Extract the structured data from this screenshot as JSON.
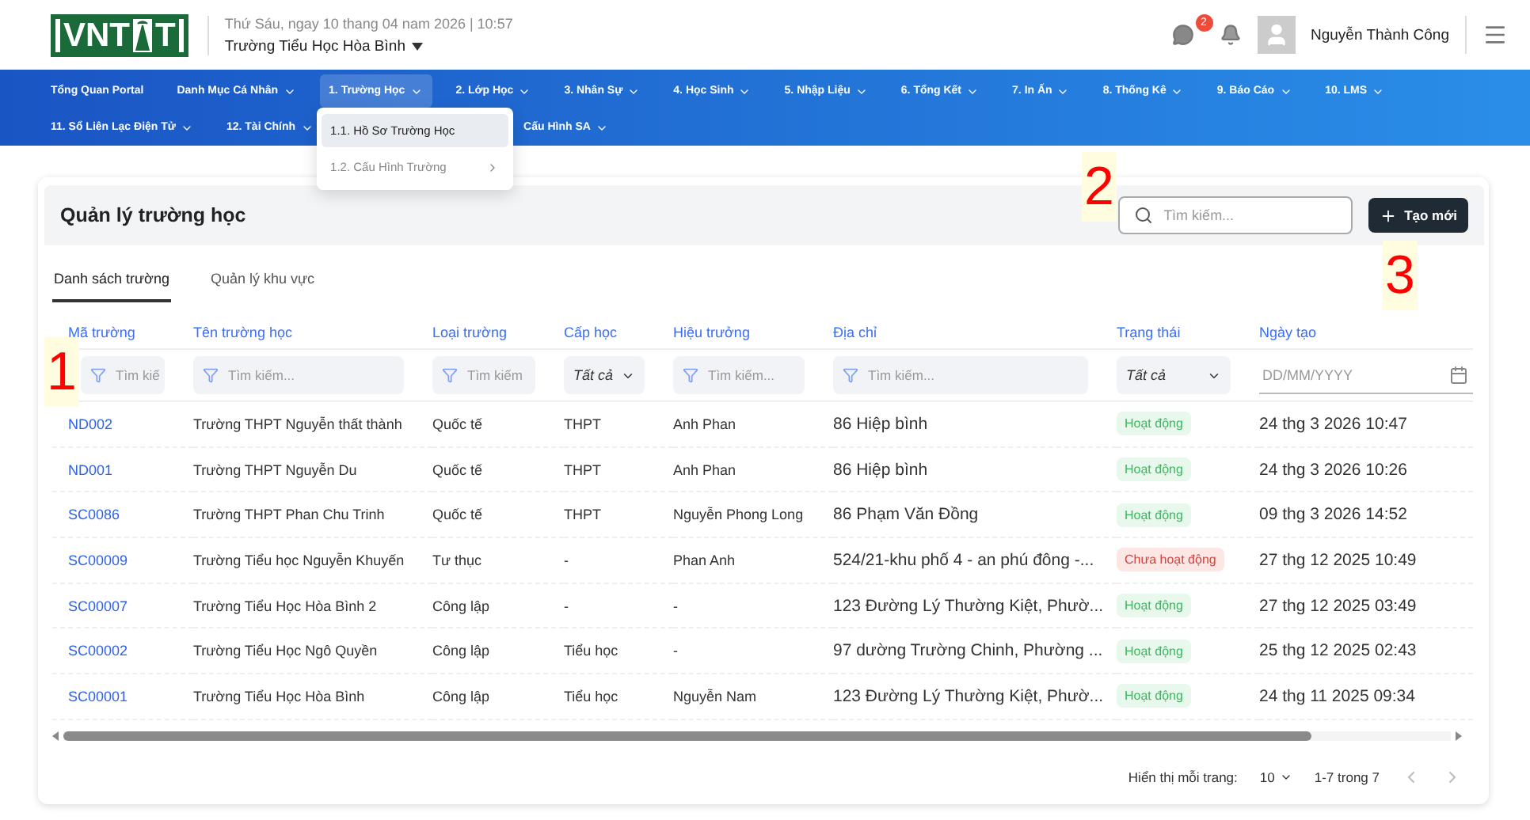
{
  "header": {
    "logo": {
      "left": "VNT",
      "right": "T"
    },
    "date": "Thứ Sáu, ngay 10 thang 04 nam 2026 | 10:57",
    "school": "Trường Tiểu Học Hòa Bình",
    "notifications": "2",
    "user": "Nguyễn Thành Công"
  },
  "nav": {
    "rows": [
      [
        {
          "label": "Tổng Quan Portal",
          "caret": false,
          "selected": false
        },
        {
          "label": "Danh Mục Cá Nhân",
          "caret": true,
          "selected": false
        },
        {
          "label": "1. Trường Học",
          "caret": true,
          "selected": true
        },
        {
          "label": "2. Lớp Học",
          "caret": true,
          "selected": false
        },
        {
          "label": "3. Nhân Sự",
          "caret": true,
          "selected": false
        },
        {
          "label": "4. Học Sinh",
          "caret": true,
          "selected": false
        },
        {
          "label": "5. Nhập Liệu",
          "caret": true,
          "selected": false
        },
        {
          "label": "6. Tổng Kết",
          "caret": true,
          "selected": false
        },
        {
          "label": "7. In Ấn",
          "caret": true,
          "selected": false
        },
        {
          "label": "8. Thống Kê",
          "caret": true,
          "selected": false
        },
        {
          "label": "9. Báo Cáo",
          "caret": true,
          "selected": false
        },
        {
          "label": "10. LMS",
          "caret": true,
          "selected": false
        }
      ],
      [
        {
          "label": "11. Sổ Liên Lạc Điện Tử",
          "caret": true,
          "selected": false
        },
        {
          "label": "12. Tài Chính",
          "caret": true,
          "selected": false
        },
        {
          "label": "Cấu Hình SA",
          "caret": true,
          "selected": false
        }
      ]
    ],
    "dropdown": [
      {
        "label": "1.1. Hồ Sơ Trường Học",
        "submenu": false,
        "selected": true
      },
      {
        "label": "1.2. Cấu Hình Trường",
        "submenu": true,
        "selected": false
      }
    ]
  },
  "page": {
    "title": "Quản lý trường học",
    "search": {
      "placeholder": "Tìm kiếm..."
    },
    "create_button": "Tạo mới",
    "tabs": [
      {
        "label": "Danh sách trường",
        "selected": true
      },
      {
        "label": "Quản lý khu vực",
        "selected": false
      }
    ]
  },
  "table": {
    "columns": [
      "Mã trường",
      "Tên trường học",
      "Loại trường",
      "Cấp học",
      "Hiệu trưởng",
      "Địa chỉ",
      "Trạng thái",
      "Ngày tạo"
    ],
    "filters": [
      {
        "kind": "text",
        "placeholder": "Tìm kiế"
      },
      {
        "kind": "text",
        "placeholder": "Tìm kiếm..."
      },
      {
        "kind": "text",
        "placeholder": "Tìm kiếm"
      },
      {
        "kind": "select",
        "value": "Tất cả"
      },
      {
        "kind": "text",
        "placeholder": "Tìm kiếm..."
      },
      {
        "kind": "text",
        "placeholder": "Tìm kiếm..."
      },
      {
        "kind": "select",
        "value": "Tất cả"
      },
      {
        "kind": "date",
        "placeholder": "DD/MM/YYYY"
      }
    ],
    "rows": [
      {
        "code": "ND002",
        "name": "Trường THPT Nguyễn thất thành",
        "type": "Quốc tế",
        "level": "THPT",
        "principal": "Anh Phan",
        "address": "86 Hiệp bình",
        "status": {
          "label": "Hoạt động",
          "kind": "active"
        },
        "created": "24 thg 3 2026 10:47"
      },
      {
        "code": "ND001",
        "name": "Trường THPT Nguyễn Du",
        "type": "Quốc tế",
        "level": "THPT",
        "principal": "Anh Phan",
        "address": "86 Hiệp bình",
        "status": {
          "label": "Hoạt động",
          "kind": "active"
        },
        "created": "24 thg 3 2026 10:26"
      },
      {
        "code": "SC0086",
        "name": "Trường THPT Phan Chu Trinh",
        "type": "Quốc tế",
        "level": "THPT",
        "principal": "Nguyễn Phong Long",
        "address": "86 Phạm Văn Đồng",
        "status": {
          "label": "Hoạt động",
          "kind": "active"
        },
        "created": "09 thg 3 2026 14:52"
      },
      {
        "code": "SC00009",
        "name": "Trường Tiểu học Nguyễn Khuyến",
        "type": "Tư thục",
        "level": "-",
        "principal": "Phan Anh",
        "address": "524/21-khu phố 4 - an phú đông -...",
        "status": {
          "label": "Chưa hoạt động",
          "kind": "inactive"
        },
        "created": "27 thg 12 2025 10:49"
      },
      {
        "code": "SC00007",
        "name": "Trường Tiểu Học Hòa Bình 2",
        "type": "Công lập",
        "level": "-",
        "principal": "-",
        "address": "123 Đường Lý Thường Kiệt, Phườ...",
        "status": {
          "label": "Hoạt động",
          "kind": "active"
        },
        "created": "27 thg 12 2025 03:49"
      },
      {
        "code": "SC00002",
        "name": "Trường Tiểu Học Ngô Quyền",
        "type": "Công lập",
        "level": "Tiểu học",
        "principal": "-",
        "address": "97 dường Trường Chinh, Phường ...",
        "status": {
          "label": "Hoạt động",
          "kind": "active"
        },
        "created": "25 thg 12 2025 02:43"
      },
      {
        "code": "SC00001",
        "name": "Trường Tiểu Học Hòa Bình",
        "type": "Công lập",
        "level": "Tiểu học",
        "principal": "Nguyễn Nam",
        "address": "123 Đường Lý Thường Kiệt, Phườ...",
        "status": {
          "label": "Hoạt động",
          "kind": "active"
        },
        "created": "24 thg 11 2025 09:34"
      }
    ]
  },
  "pagination": {
    "label": "Hiển thị mỗi trang:",
    "page_size": "10",
    "range": "1-7 trong 7"
  },
  "callouts": [
    "1",
    "2",
    "3"
  ]
}
